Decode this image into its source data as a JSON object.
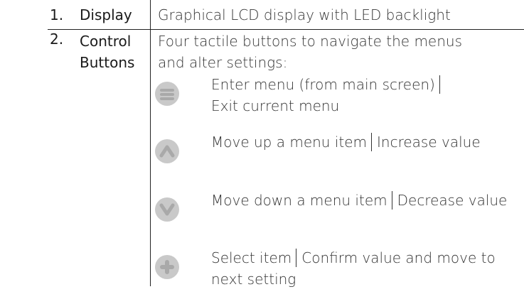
{
  "rows": [
    {
      "number": "1.",
      "label": "Display",
      "description": "Graphical LCD display with LED backlight"
    },
    {
      "number": "2.",
      "label_line1": "Control",
      "label_line2": "Buttons",
      "description_line1": "Four tactile buttons to navigate the menus",
      "description_line2": "and alter settings:"
    }
  ],
  "buttons": [
    {
      "icon": "menu-icon",
      "action_a": "Enter menu (from main screen)",
      "action_b": "Exit current menu"
    },
    {
      "icon": "chevron-up-icon",
      "action_a": "Move up a menu item",
      "action_b": "Increase value"
    },
    {
      "icon": "chevron-down-icon",
      "action_a": "Move down a menu item",
      "action_b": "Decrease value"
    },
    {
      "icon": "plus-icon",
      "action_a": "Select item",
      "action_b": "Confirm value and move to next setting"
    }
  ],
  "colors": {
    "button_face": "#c9c9c9",
    "button_glyph": "#a9a9a9",
    "rule": "#222222"
  }
}
